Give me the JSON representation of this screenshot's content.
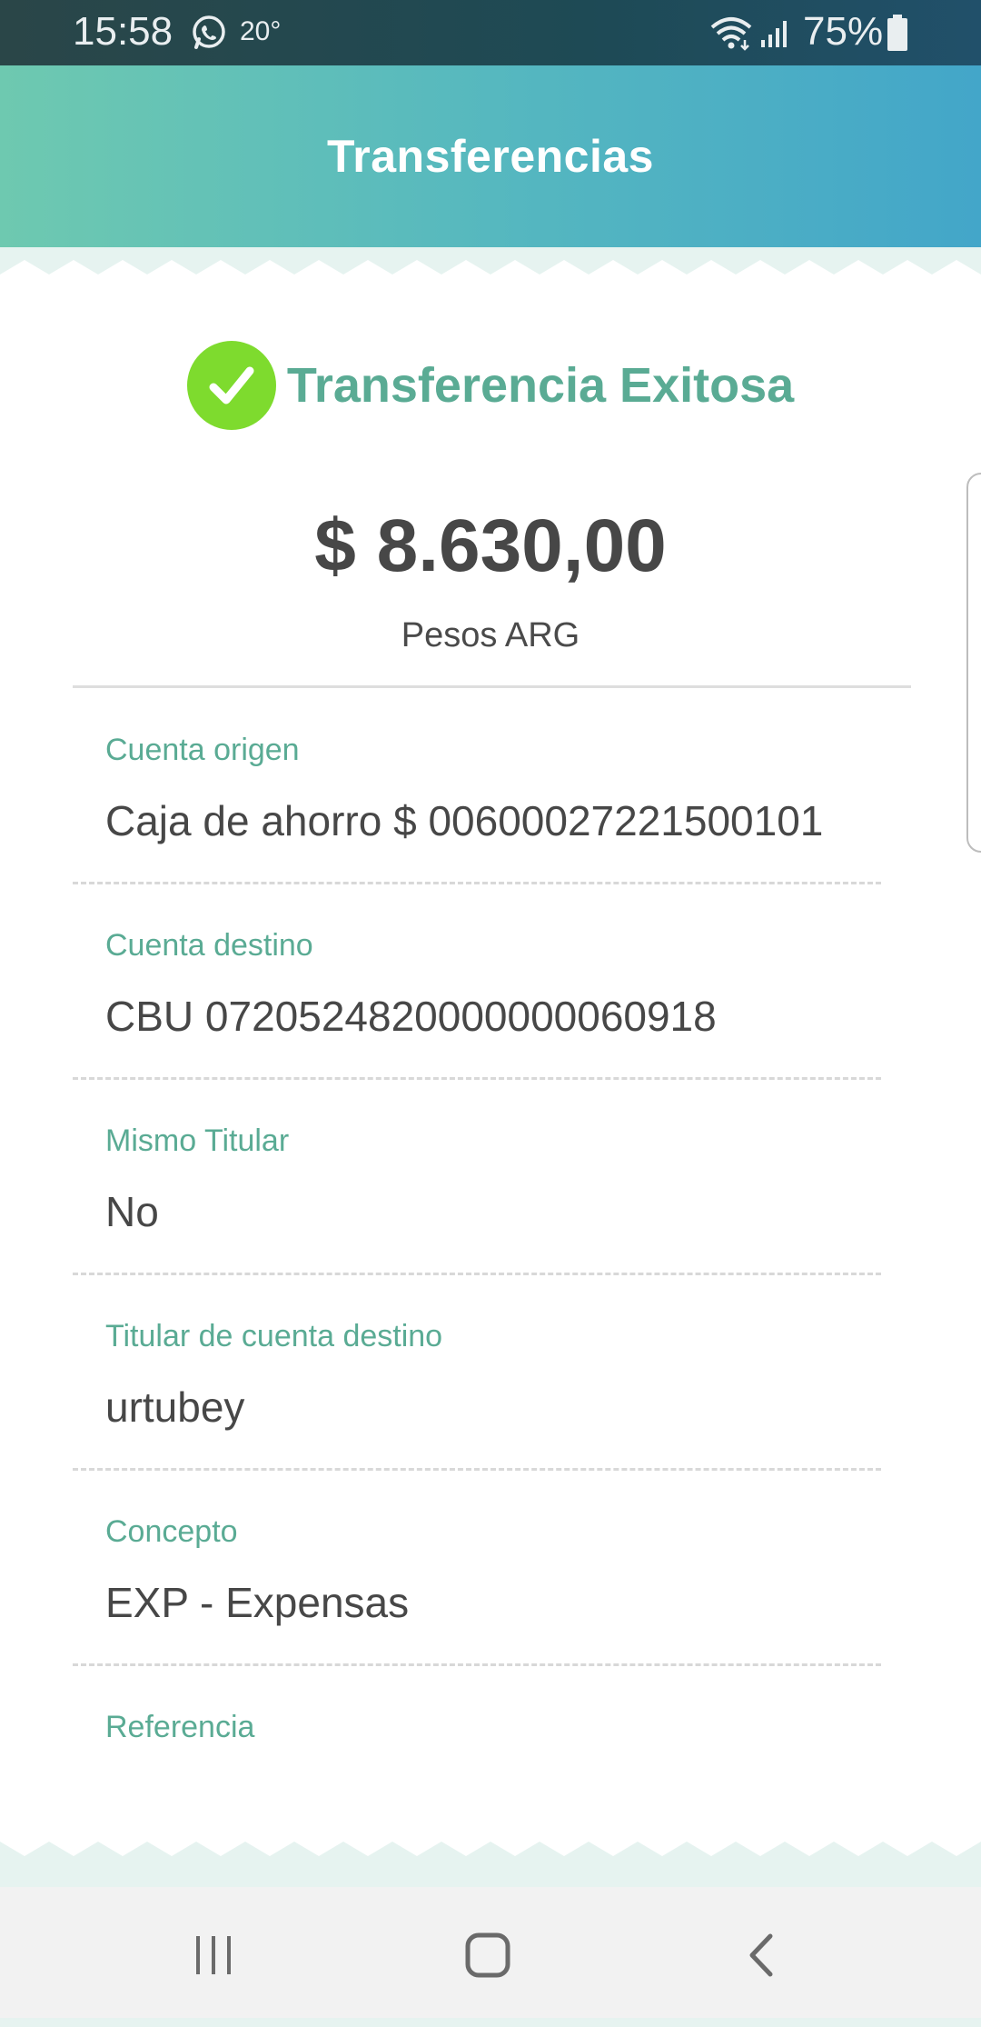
{
  "status_bar": {
    "time": "15:58",
    "temperature": "20°",
    "battery": "75%"
  },
  "header": {
    "title": "Transferencias"
  },
  "receipt": {
    "status_text": "Transferencia Exitosa",
    "amount": "$ 8.630,00",
    "currency": "Pesos ARG",
    "details": [
      {
        "label": "Cuenta origen",
        "value": "Caja de ahorro $ 00600027221500101"
      },
      {
        "label": "Cuenta destino",
        "value": "CBU 0720524820000000060918"
      },
      {
        "label": "Mismo Titular",
        "value": "No"
      },
      {
        "label": "Titular de cuenta destino",
        "value": "urtubey"
      },
      {
        "label": "Concepto",
        "value": "EXP - Expensas"
      },
      {
        "label": "Referencia",
        "value": ""
      }
    ]
  },
  "colors": {
    "accent": "#5aab94",
    "success": "#7edb2e",
    "header_gradient_start": "#6ec9b0",
    "header_gradient_end": "#43a6c9"
  },
  "icons": {
    "status": [
      "whatsapp-icon",
      "wifi-icon",
      "signal-icon",
      "battery-icon"
    ],
    "success": "check-icon",
    "nav": [
      "recent-apps-icon",
      "home-icon",
      "back-icon"
    ]
  }
}
